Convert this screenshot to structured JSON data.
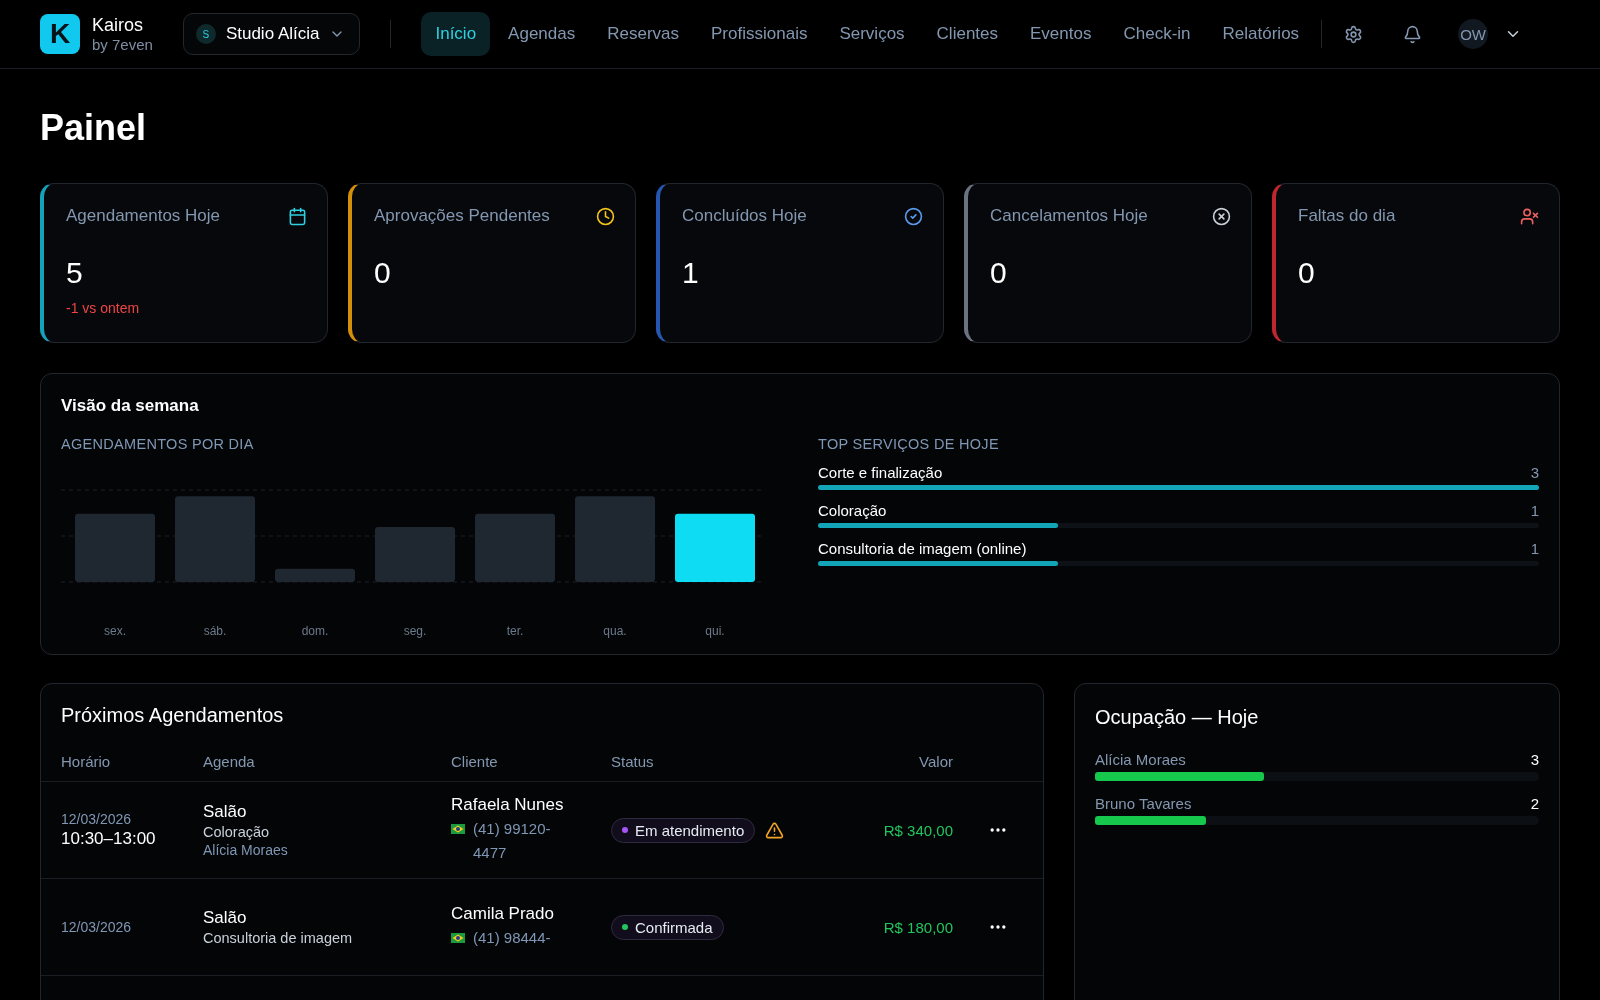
{
  "brand": {
    "logo_letter": "K",
    "name": "Kairos",
    "by": "by 7even"
  },
  "workspace": {
    "initial": "S",
    "name": "Studio Alícia"
  },
  "nav": [
    {
      "label": "Início",
      "selected": true
    },
    {
      "label": "Agendas",
      "selected": false
    },
    {
      "label": "Reservas",
      "selected": false
    },
    {
      "label": "Profissionais",
      "selected": false
    },
    {
      "label": "Serviços",
      "selected": false
    },
    {
      "label": "Clientes",
      "selected": false
    },
    {
      "label": "Eventos",
      "selected": false
    },
    {
      "label": "Check-in",
      "selected": false
    },
    {
      "label": "Relatórios",
      "selected": false
    }
  ],
  "user": {
    "initials": "OW"
  },
  "page_title": "Painel",
  "stats": [
    {
      "label": "Agendamentos Hoje",
      "value": "5",
      "delta": "-1 vs ontem",
      "color": "#14a3b8"
    },
    {
      "label": "Aprovações Pendentes",
      "value": "0",
      "color": "#d4900a"
    },
    {
      "label": "Concluídos Hoje",
      "value": "1",
      "color": "#2556b0"
    },
    {
      "label": "Cancelamentos Hoje",
      "value": "0",
      "color": "#6b7280"
    },
    {
      "label": "Faltas do dia",
      "value": "0",
      "color": "#c0262d"
    }
  ],
  "week": {
    "title": "Visão da semana",
    "chart_title": "AGENDAMENTOS POR DIA",
    "days": [
      {
        "label": "sex.",
        "selected": false
      },
      {
        "label": "sáb.",
        "selected": false
      },
      {
        "label": "dom.",
        "selected": false
      },
      {
        "label": "seg.",
        "selected": false
      },
      {
        "label": "ter.",
        "selected": false
      },
      {
        "label": "qua.",
        "selected": false
      },
      {
        "label": "qui.",
        "selected": true
      }
    ],
    "services_title": "TOP SERVIÇOS DE HOJE",
    "services": [
      {
        "name": "Corte e finalização",
        "count": "3",
        "level": 1
      },
      {
        "name": "Coloração",
        "count": "1",
        "level": 0.333
      },
      {
        "name": "Consultoria de imagem (online)",
        "count": "1",
        "level": 0.333
      }
    ]
  },
  "appointments": {
    "title": "Próximos Agendamentos",
    "columns": [
      "Horário",
      "Agenda",
      "Cliente",
      "Status",
      "Valor"
    ],
    "rows": [
      {
        "date": "12/03/2026",
        "time": "10:30–13:00",
        "agenda": "Salão",
        "service": "Coloração",
        "professional": "Alícia Moraes",
        "client": "Rafaela Nunes",
        "phone": "(41) 99120-4477",
        "status": "Em atendimento",
        "color": "#a855f7",
        "alert": true,
        "value": "R$ 340,00"
      },
      {
        "date": "12/03/2026",
        "agenda": "Salão",
        "service": "Consultoria de imagem",
        "client": "Camila Prado",
        "phone": "(41) 98444-",
        "status": "Confirmada",
        "color": "#22c55e",
        "alert": false,
        "value": "R$ 180,00"
      }
    ]
  },
  "occupancy": {
    "title": "Ocupação — Hoje",
    "items": [
      {
        "name": "Alícia Moraes",
        "count": "3",
        "level": 0.38
      },
      {
        "name": "Bruno Tavares",
        "count": "2",
        "level": 0.25
      }
    ]
  }
}
